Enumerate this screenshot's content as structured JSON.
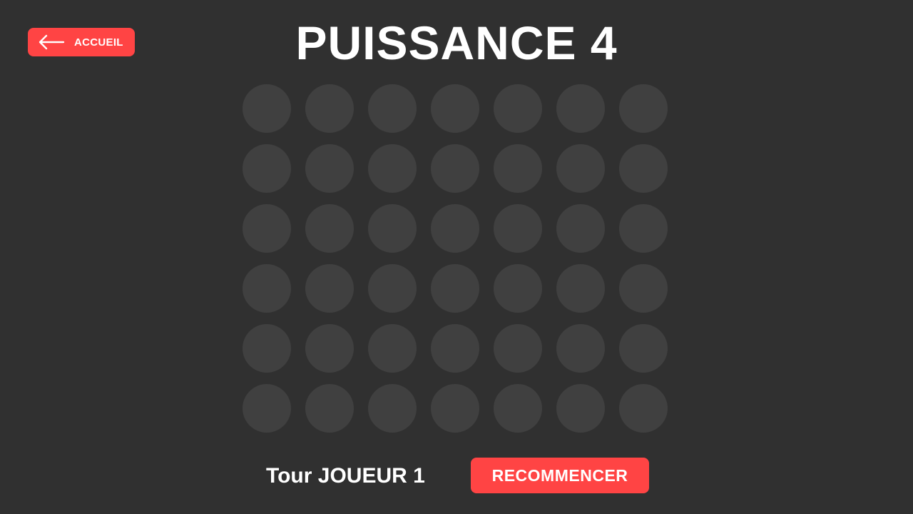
{
  "header": {
    "home_label": "ACCUEIL",
    "home_icon": "arrow-left-icon",
    "title": "PUISSANCE 4"
  },
  "board": {
    "rows": 6,
    "columns": 7,
    "cells": [
      [
        "empty",
        "empty",
        "empty",
        "empty",
        "empty",
        "empty",
        "empty"
      ],
      [
        "empty",
        "empty",
        "empty",
        "empty",
        "empty",
        "empty",
        "empty"
      ],
      [
        "empty",
        "empty",
        "empty",
        "empty",
        "empty",
        "empty",
        "empty"
      ],
      [
        "empty",
        "empty",
        "empty",
        "empty",
        "empty",
        "empty",
        "empty"
      ],
      [
        "empty",
        "empty",
        "empty",
        "empty",
        "empty",
        "empty",
        "empty"
      ],
      [
        "empty",
        "empty",
        "empty",
        "empty",
        "empty",
        "empty",
        "empty"
      ]
    ]
  },
  "footer": {
    "turn_text": "Tour JOUEUR 1",
    "restart_label": "RECOMMENCER"
  },
  "colors": {
    "background": "#303030",
    "empty_cell": "#404040",
    "accent": "#ff4444",
    "text": "#ffffff"
  }
}
